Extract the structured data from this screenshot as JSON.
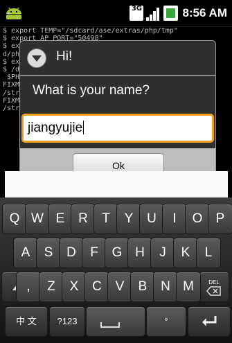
{
  "status_bar": {
    "time": "8:56 AM",
    "network": "3G"
  },
  "terminal": {
    "lines": [
      "$ export TEMP=\"/sdcard/ase/extras/php/tmp\"",
      "$ export AP_PORT=\"50498\"",
      "$ export PHPRC=\"/sdcard/ase/extras/php/",
      "d/php.ini\"",
      "$ export PHP_INI_SCAN_DIR=\"\"",
      "$ /data/data/com.google.ase/php/php -c",
      " $PHPRC",
      "FIXME: ...aste@ ruby/plugin/Android-c",
      "/str.php",
      "FIXME: ...aste@ ruby/plugin/Android-c",
      "/str.php"
    ]
  },
  "dialog": {
    "title": "Hi!",
    "message": "What is your name?",
    "input_value": "jiangyujie",
    "ok_label": "Ok"
  },
  "keyboard": {
    "row1": [
      "Q",
      "W",
      "E",
      "R",
      "T",
      "Y",
      "U",
      "I",
      "O",
      "P"
    ],
    "row2": [
      "A",
      "S",
      "D",
      "F",
      "G",
      "H",
      "J",
      "K",
      "L"
    ],
    "row3": [
      ",",
      "Z",
      "X",
      "C",
      "V",
      "B",
      "N",
      "M"
    ],
    "del_label": "DEL",
    "lang_label": "中 文",
    "symbols_label": "?123",
    "dot_label": "°"
  }
}
